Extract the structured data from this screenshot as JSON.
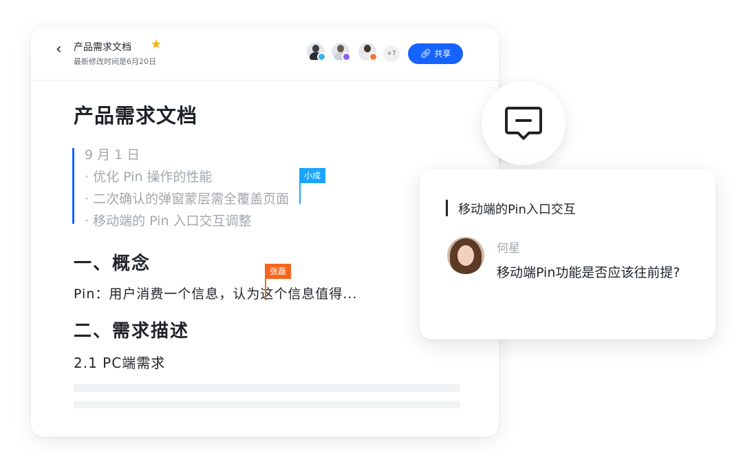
{
  "header": {
    "back_icon": "chevron-left-icon",
    "title": "产品需求文档",
    "star_icon": "star-icon",
    "modified": "最新修改时间是6月20日",
    "collaborators": [
      {
        "status_color": "#3ab1f0"
      },
      {
        "status_color": "#8a5cf5"
      },
      {
        "status_color": "#f07c3a"
      }
    ],
    "more_count": "+7",
    "share_label": "共享",
    "share_icon": "link-icon"
  },
  "doc": {
    "title": "产品需求文档",
    "quote": {
      "lines": [
        "9 月 1 日",
        "· 优化 Pin 操作的性能",
        "· 二次确认的弹窗蒙层需全覆盖页面",
        "· 移动端的 Pin 入口交互调整"
      ]
    },
    "cursors": [
      {
        "name": "小成",
        "color": "#1aa4ff"
      },
      {
        "name": "张磊",
        "color": "#f5651e"
      }
    ],
    "section1": "一、概念",
    "paragraph1_before": "Pin：用户消费一个信息，",
    "paragraph1_after": "认为这个信息值得...",
    "section2": "二、需求描述",
    "subsection": "2.1 PC端需求"
  },
  "comment": {
    "bubble_icon": "comment-icon",
    "quote": "移动端的Pin入口交互",
    "author": "何星",
    "text": "移动端Pin功能是否应该往前提?"
  },
  "colors": {
    "accent": "#1664ff",
    "cursor_blue": "#1aa4ff",
    "cursor_orange": "#f5651e"
  }
}
